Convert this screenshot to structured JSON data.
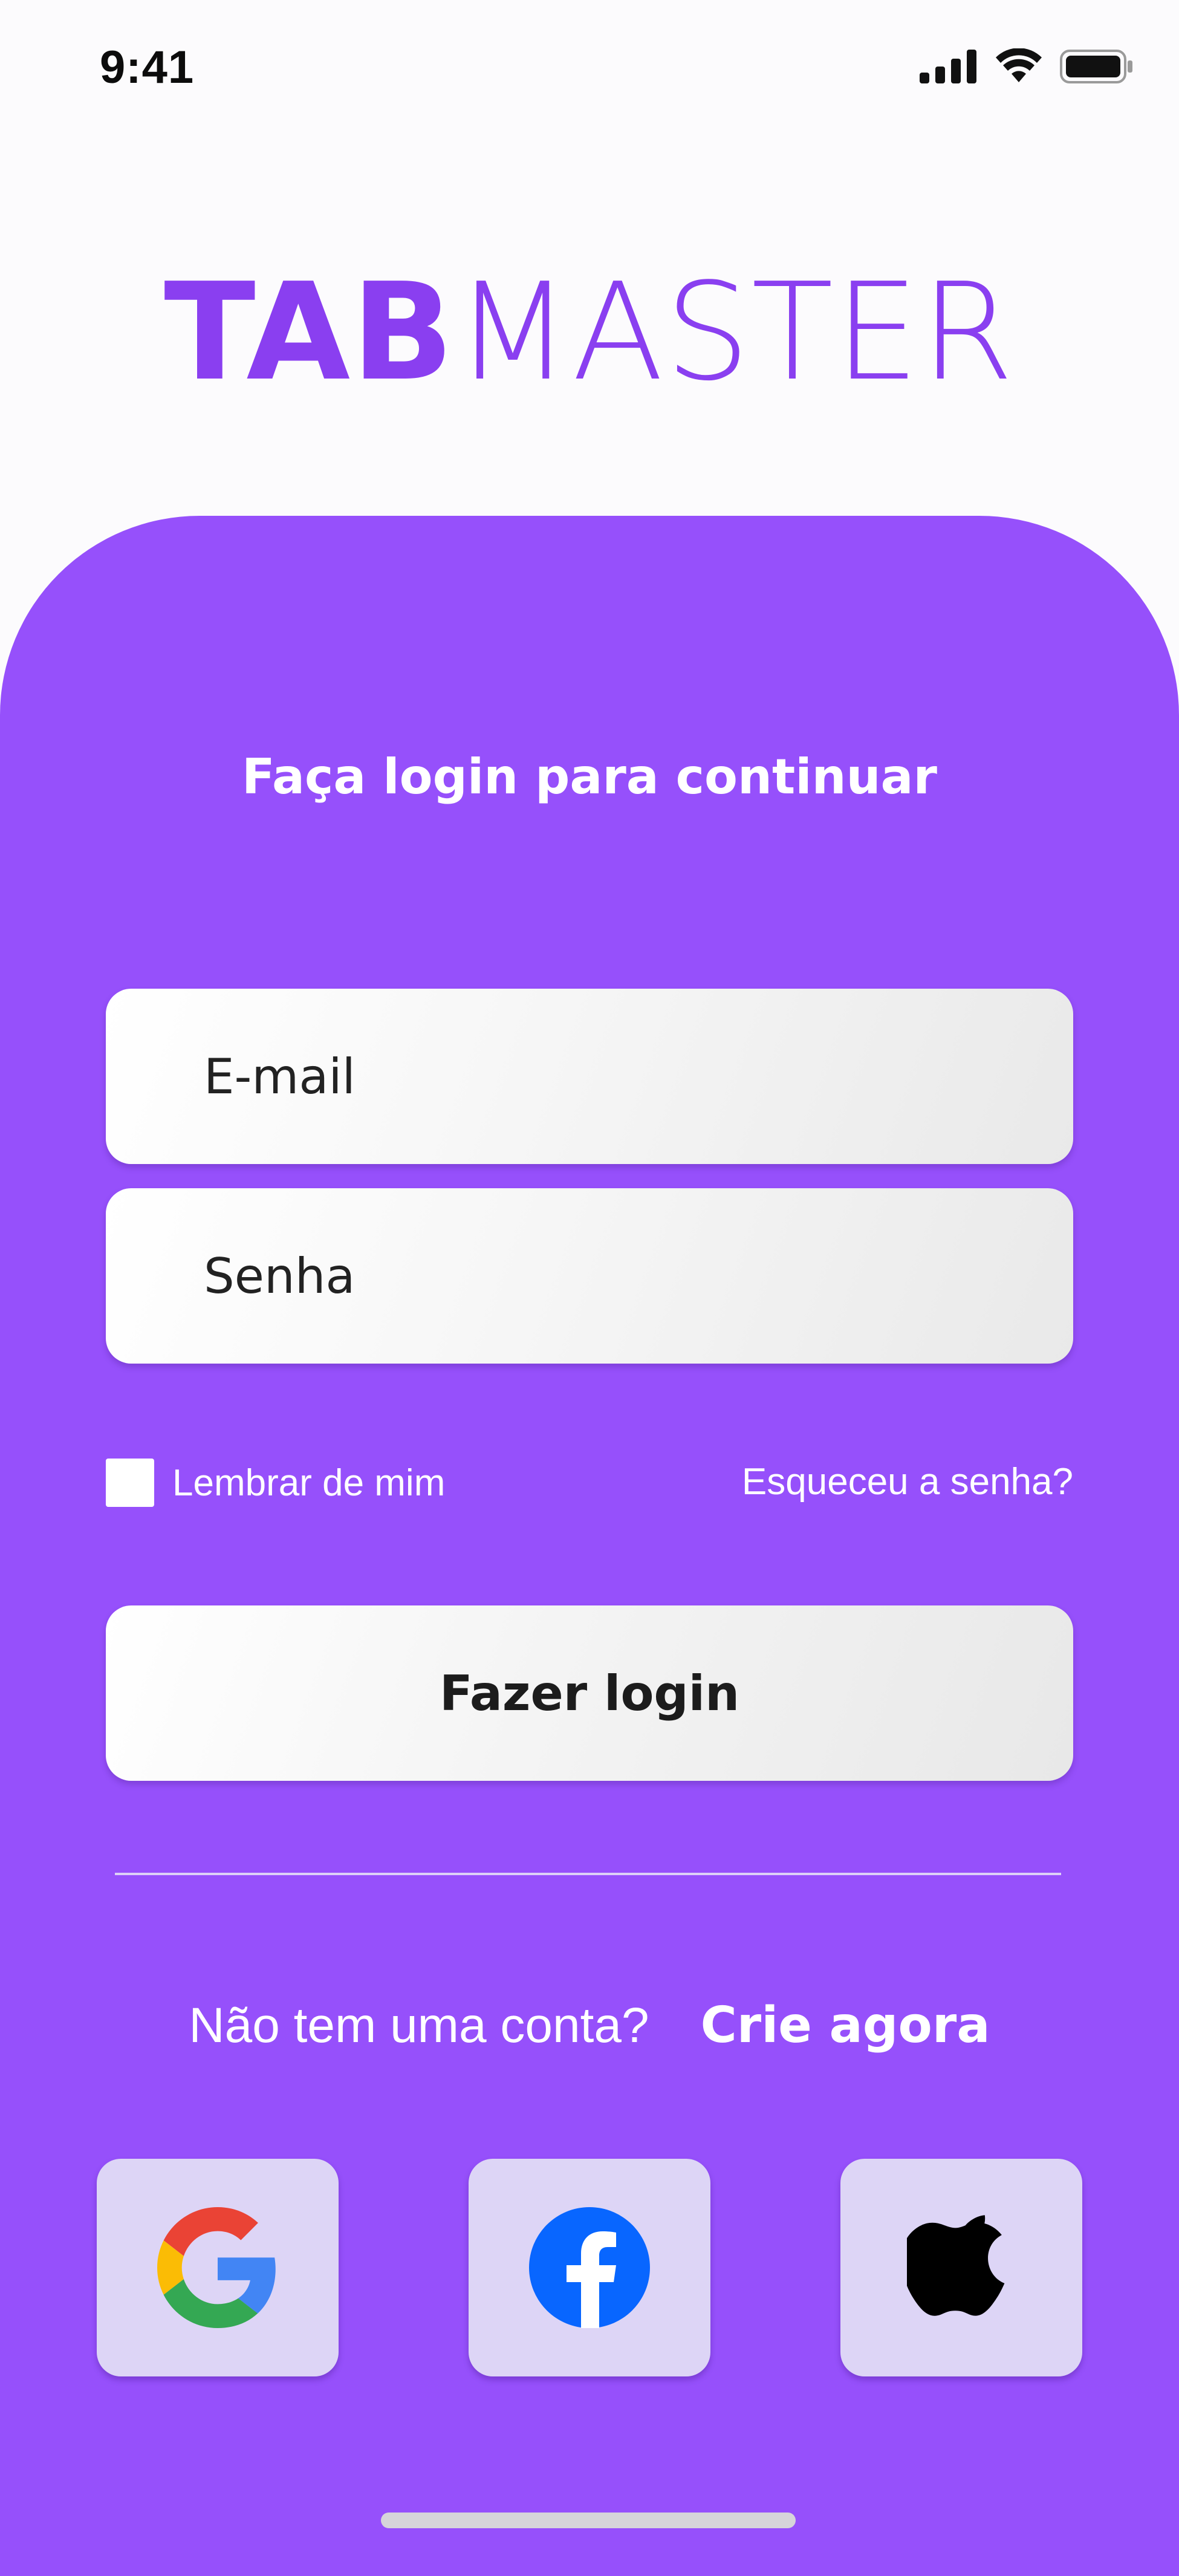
{
  "status_bar": {
    "time": "9:41",
    "icons": [
      "signal-icon",
      "wifi-icon",
      "battery-icon"
    ]
  },
  "logo": {
    "bold": "TAB",
    "light": "MASTER"
  },
  "form": {
    "title": "Faça login para continuar",
    "email_placeholder": "E-mail",
    "password_placeholder": "Senha",
    "remember_label": "Lembrar de mim",
    "forgot_label": "Esqueceu a senha?",
    "login_label": "Fazer login"
  },
  "signup": {
    "question": "Não tem uma conta?",
    "link": "Crie agora"
  },
  "social_logins": [
    "google-icon",
    "facebook-icon",
    "apple-icon"
  ],
  "colors": {
    "brand_purple": "#9650fb",
    "logo_purple": "#8a3ff0",
    "social_tile": "#ddd5f6",
    "background": "#fcfbfd"
  }
}
